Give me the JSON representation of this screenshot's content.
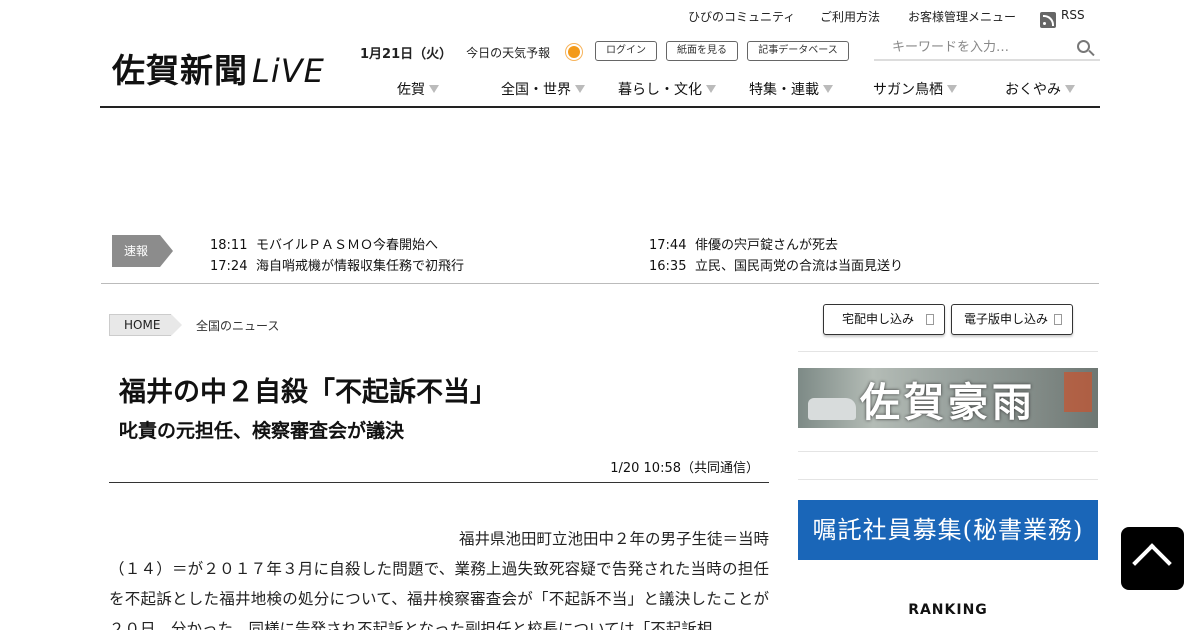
{
  "util_links": {
    "community": "ひびのコミュニティ",
    "usage": "ご利用方法",
    "customer": "お客様管理メニュー",
    "rss": "RSS"
  },
  "logo": {
    "jp": "佐賀新聞",
    "live": "LiVE"
  },
  "datebar": {
    "date": "1月21日（火）",
    "weather": "今日の天気予報",
    "weather_icon": "sun-icon"
  },
  "buttons": {
    "login": "ログイン",
    "paper": "紙面を見る",
    "database": "記事データベース"
  },
  "search": {
    "placeholder": "キーワードを入力…"
  },
  "nav": [
    "佐賀",
    "全国・世界",
    "暮らし・文化",
    "特集・連載",
    "サガン鳥栖",
    "おくやみ"
  ],
  "breaking": {
    "label": "速報",
    "items": [
      {
        "time": "18:11",
        "text": "モバイルＰＡＳＭＯ今春開始へ"
      },
      {
        "time": "17:44",
        "text": "俳優の宍戸錠さんが死去"
      },
      {
        "time": "17:24",
        "text": "海自哨戒機が情報収集任務で初飛行"
      },
      {
        "time": "16:35",
        "text": "立民、国民両党の合流は当面見送り"
      }
    ]
  },
  "breadcrumb": {
    "home": "HOME",
    "current": "全国のニュース"
  },
  "article": {
    "title": "福井の中２自殺「不起訴不当」",
    "subtitle": "叱責の元担任、検察審査会が議決",
    "dateline": "1/20 10:58（共同通信）",
    "body_first": "福井県池田町立池田中２年の男子生徒＝当時",
    "body_rest": "（１４）＝が２０１７年３月に自殺した問題で、業務上過失致死容疑で告発された当時の担任を不起訴とした福井地検の処分について、福井検察審査会が「不起訴不当」と議決したことが２０日、分かった。同様に告発され不起訴となった副担任と校長については「不起訴相"
  },
  "sidebar": {
    "home_delivery": "宅配申し込み",
    "e_edition": "電子版申し込み",
    "banner1": "佐賀豪雨",
    "banner2": "嘱託社員募集(秘書業務)",
    "ranking": "RANKING"
  }
}
